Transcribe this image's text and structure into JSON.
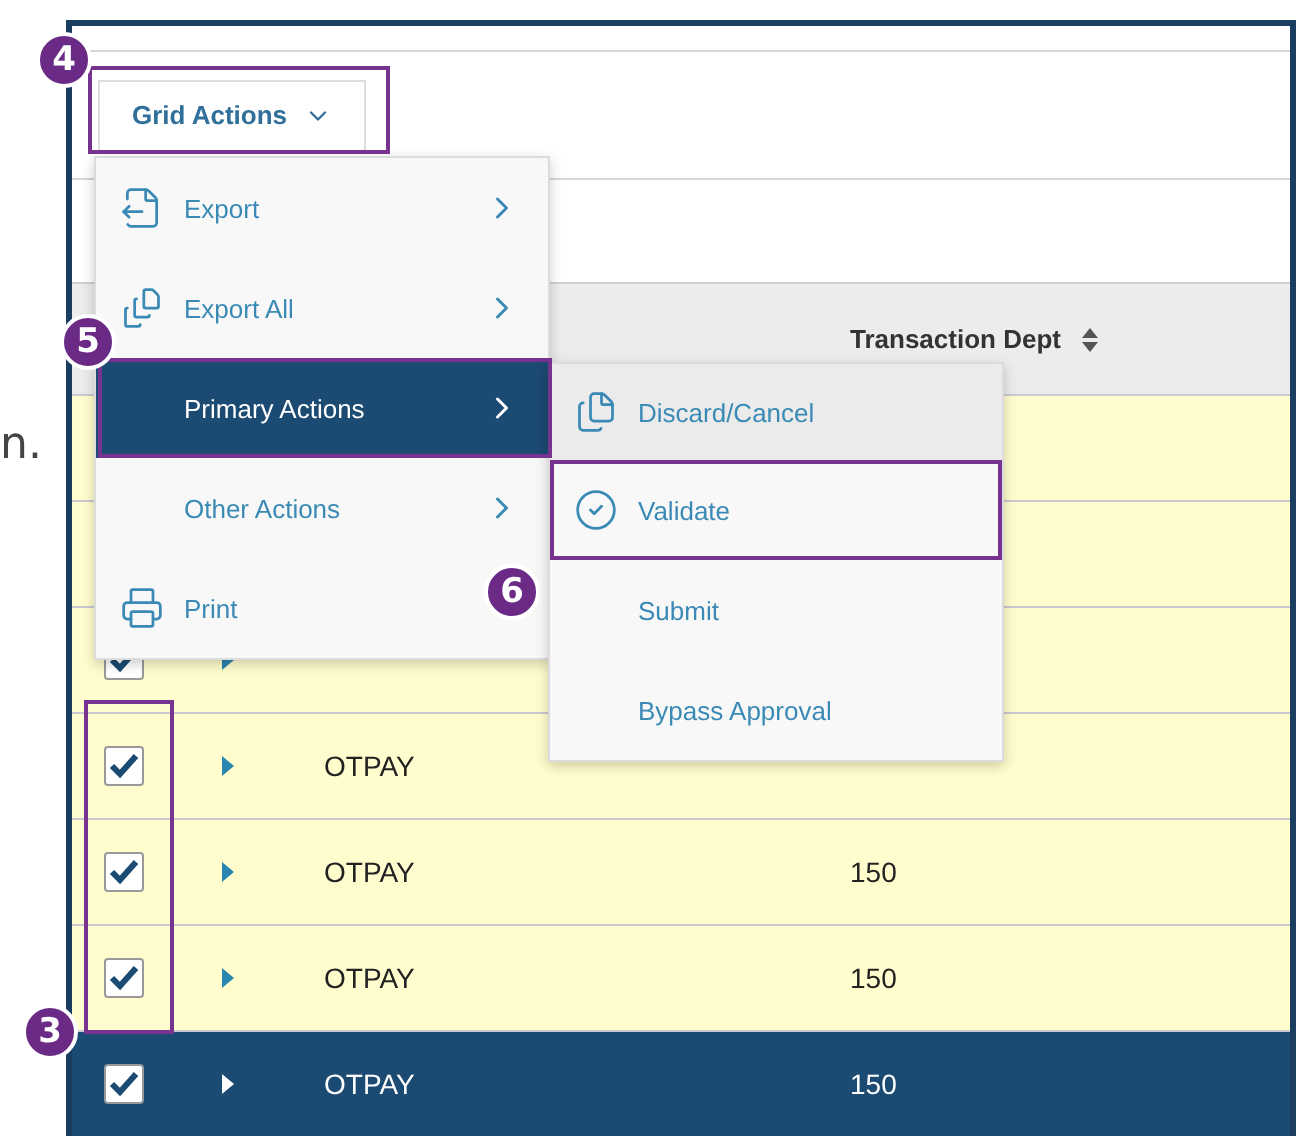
{
  "side_text": "n.",
  "toolbar": {
    "button": {
      "label": "Grid Actions"
    }
  },
  "grid": {
    "columns": [
      {
        "label": "Transaction Dept"
      }
    ],
    "rows": [
      {
        "selected": false
      },
      {
        "selected": false
      },
      {
        "selected": false,
        "checked": true
      },
      {
        "selected": false,
        "checked": true,
        "code": "OTPAY"
      },
      {
        "selected": false,
        "checked": true,
        "code": "OTPAY",
        "dept": "150"
      },
      {
        "selected": false,
        "checked": true,
        "code": "OTPAY",
        "dept": "150"
      },
      {
        "selected": true,
        "checked": true,
        "code": "OTPAY",
        "dept": "150"
      }
    ]
  },
  "menu": {
    "items": [
      {
        "label": "Export",
        "submenu": true,
        "selected": false
      },
      {
        "label": "Export All",
        "submenu": true,
        "selected": false
      },
      {
        "label": "Primary Actions",
        "submenu": true,
        "selected": true
      },
      {
        "label": "Other Actions",
        "submenu": true,
        "selected": false
      },
      {
        "label": "Print",
        "submenu": false,
        "selected": false
      }
    ]
  },
  "submenu": {
    "items": [
      {
        "label": "Discard/Cancel",
        "hovered": true
      },
      {
        "label": "Validate",
        "hovered": false
      },
      {
        "label": "Submit",
        "hovered": false
      },
      {
        "label": "Bypass Approval",
        "hovered": false
      }
    ]
  },
  "callouts": [
    {
      "number": "4"
    },
    {
      "number": "5"
    },
    {
      "number": "6"
    },
    {
      "number": "3"
    }
  ]
}
